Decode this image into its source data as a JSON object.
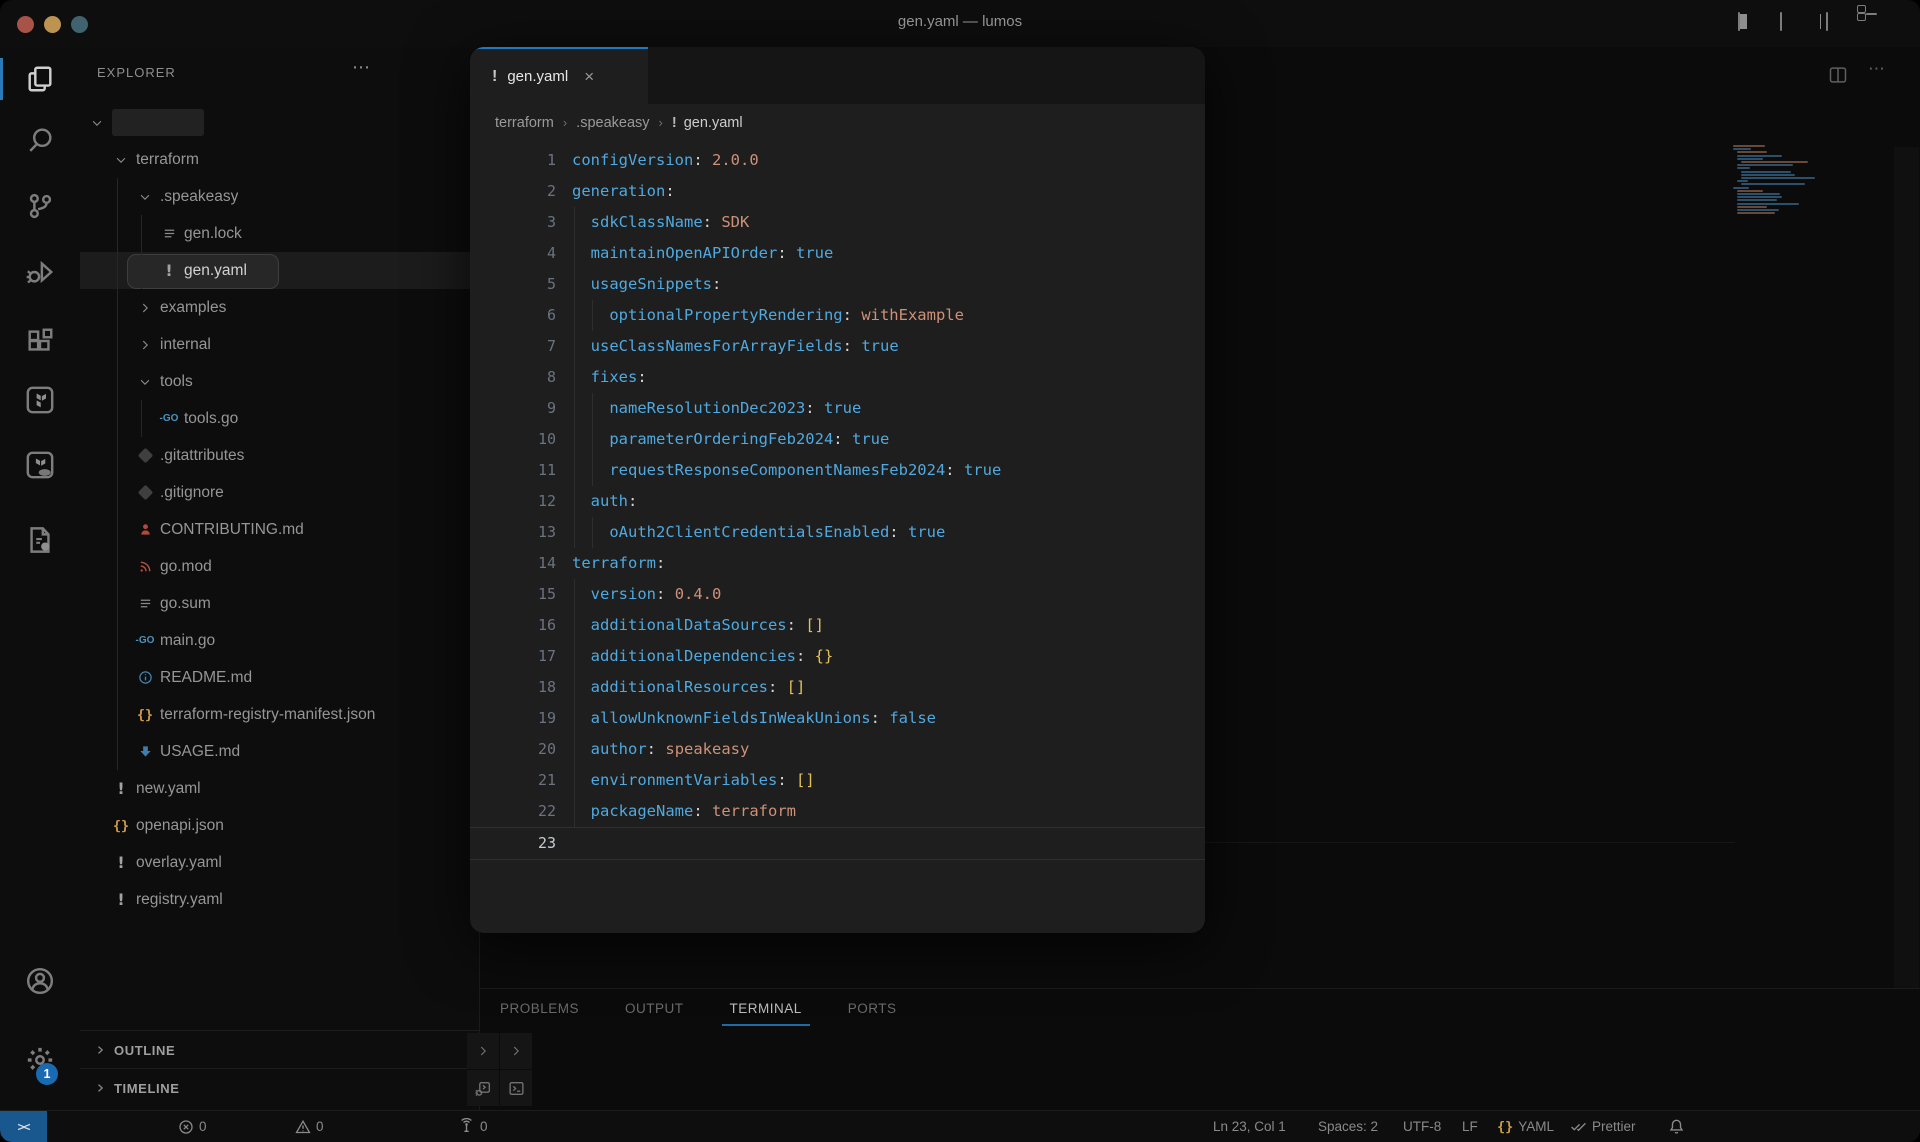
{
  "window": {
    "title": "gen.yaml — lumos",
    "traffic_lights": [
      "#a8534a",
      "#bd9350",
      "#41626f"
    ]
  },
  "titlebar_icons": [
    "layout-sidebar-left",
    "layout-panel",
    "layout-sidebar-right",
    "layout-customize"
  ],
  "activity_bar": {
    "items": [
      {
        "name": "explorer",
        "icon": "files",
        "active": true
      },
      {
        "name": "search",
        "icon": "search",
        "active": false
      },
      {
        "name": "source-control",
        "icon": "source-control",
        "active": false
      },
      {
        "name": "run-debug",
        "icon": "debug",
        "active": false
      },
      {
        "name": "extensions",
        "icon": "extensions",
        "active": false
      },
      {
        "name": "terraform",
        "icon": "terraform",
        "active": false
      },
      {
        "name": "terraform-cloud",
        "icon": "terraform-cloud",
        "active": false
      },
      {
        "name": "rest-client",
        "icon": "tool-file",
        "active": false
      },
      {
        "name": "accounts",
        "icon": "account",
        "active": false,
        "bottom": true
      },
      {
        "name": "settings",
        "icon": "gear",
        "active": false,
        "bottom": true,
        "badge": "1"
      }
    ]
  },
  "explorer": {
    "header": "EXPLORER",
    "more_label": "⋯",
    "tree": [
      {
        "label": "",
        "chev": "down",
        "level": 0,
        "blurred": true
      },
      {
        "label": "terraform",
        "chev": "down",
        "level": 1
      },
      {
        "label": ".speakeasy",
        "chev": "down",
        "level": 2,
        "guides": [
          1
        ]
      },
      {
        "label": "gen.lock",
        "icon": "list",
        "level": 3,
        "guides": [
          1,
          2
        ]
      },
      {
        "label": "gen.yaml",
        "icon": "warning",
        "level": 3,
        "guides": [
          1,
          2
        ],
        "selected": true
      },
      {
        "label": "examples",
        "chev": "right",
        "level": 2,
        "guides": [
          1
        ]
      },
      {
        "label": "internal",
        "chev": "right",
        "level": 2,
        "guides": [
          1
        ]
      },
      {
        "label": "tools",
        "chev": "down",
        "level": 2,
        "guides": [
          1
        ]
      },
      {
        "label": "tools.go",
        "icon": "go",
        "level": 3,
        "guides": [
          1,
          2
        ]
      },
      {
        "label": ".gitattributes",
        "icon": "git",
        "level": 2,
        "guides": [
          1
        ]
      },
      {
        "label": ".gitignore",
        "icon": "git",
        "level": 2,
        "guides": [
          1
        ]
      },
      {
        "label": "CONTRIBUTING.md",
        "icon": "person",
        "level": 2,
        "guides": [
          1
        ]
      },
      {
        "label": "go.mod",
        "icon": "gomod",
        "level": 2,
        "guides": [
          1
        ]
      },
      {
        "label": "go.sum",
        "icon": "list",
        "level": 2,
        "guides": [
          1
        ]
      },
      {
        "label": "main.go",
        "icon": "go",
        "level": 2,
        "guides": [
          1
        ]
      },
      {
        "label": "README.md",
        "icon": "info",
        "level": 2,
        "guides": [
          1
        ]
      },
      {
        "label": "terraform-registry-manifest.json",
        "icon": "braces",
        "level": 2,
        "guides": [
          1
        ]
      },
      {
        "label": "USAGE.md",
        "icon": "arrow-down",
        "level": 2,
        "guides": [
          1
        ]
      },
      {
        "label": "new.yaml",
        "icon": "warning",
        "level": 1
      },
      {
        "label": "openapi.json",
        "icon": "braces",
        "level": 1
      },
      {
        "label": "overlay.yaml",
        "icon": "warning",
        "level": 1
      },
      {
        "label": "registry.yaml",
        "icon": "warning",
        "level": 1
      }
    ],
    "sections": {
      "outline": "OUTLINE",
      "timeline": "TIMELINE"
    }
  },
  "editor": {
    "tab": {
      "label": "gen.yaml",
      "icon": "warning",
      "close": "×"
    },
    "breadcrumb": [
      {
        "label": "terraform"
      },
      {
        "label": ".speakeasy"
      },
      {
        "label": "gen.yaml",
        "icon": "warning"
      }
    ],
    "lines": [
      {
        "n": 1,
        "indent": 0,
        "key": "configVersion",
        "val": "2.0.0",
        "vt": "str"
      },
      {
        "n": 2,
        "indent": 0,
        "key": "generation"
      },
      {
        "n": 3,
        "indent": 1,
        "key": "sdkClassName",
        "val": "SDK",
        "vt": "str"
      },
      {
        "n": 4,
        "indent": 1,
        "key": "maintainOpenAPIOrder",
        "val": "true",
        "vt": "kw"
      },
      {
        "n": 5,
        "indent": 1,
        "key": "usageSnippets"
      },
      {
        "n": 6,
        "indent": 2,
        "key": "optionalPropertyRendering",
        "val": "withExample",
        "vt": "str"
      },
      {
        "n": 7,
        "indent": 1,
        "key": "useClassNamesForArrayFields",
        "val": "true",
        "vt": "kw"
      },
      {
        "n": 8,
        "indent": 1,
        "key": "fixes"
      },
      {
        "n": 9,
        "indent": 2,
        "key": "nameResolutionDec2023",
        "val": "true",
        "vt": "kw"
      },
      {
        "n": 10,
        "indent": 2,
        "key": "parameterOrderingFeb2024",
        "val": "true",
        "vt": "kw"
      },
      {
        "n": 11,
        "indent": 2,
        "key": "requestResponseComponentNamesFeb2024",
        "val": "true",
        "vt": "kw"
      },
      {
        "n": 12,
        "indent": 1,
        "key": "auth"
      },
      {
        "n": 13,
        "indent": 2,
        "key": "oAuth2ClientCredentialsEnabled",
        "val": "true",
        "vt": "kw"
      },
      {
        "n": 14,
        "indent": 0,
        "key": "terraform"
      },
      {
        "n": 15,
        "indent": 1,
        "key": "version",
        "val": "0.4.0",
        "vt": "str"
      },
      {
        "n": 16,
        "indent": 1,
        "key": "additionalDataSources",
        "val": "[]",
        "vt": "br"
      },
      {
        "n": 17,
        "indent": 1,
        "key": "additionalDependencies",
        "val": "{}",
        "vt": "br"
      },
      {
        "n": 18,
        "indent": 1,
        "key": "additionalResources",
        "val": "[]",
        "vt": "br"
      },
      {
        "n": 19,
        "indent": 1,
        "key": "allowUnknownFieldsInWeakUnions",
        "val": "false",
        "vt": "kw"
      },
      {
        "n": 20,
        "indent": 1,
        "key": "author",
        "val": "speakeasy",
        "vt": "str"
      },
      {
        "n": 21,
        "indent": 1,
        "key": "environmentVariables",
        "val": "[]",
        "vt": "br"
      },
      {
        "n": 22,
        "indent": 1,
        "key": "packageName",
        "val": "terraform",
        "vt": "str"
      },
      {
        "n": 23,
        "indent": 0,
        "current": true
      }
    ]
  },
  "panel": {
    "tabs": [
      {
        "label": "PROBLEMS",
        "active": false
      },
      {
        "label": "OUTPUT",
        "active": false
      },
      {
        "label": "TERMINAL",
        "active": true
      },
      {
        "label": "PORTS",
        "active": false
      }
    ],
    "corner_icons": [
      "chevron-right",
      "chevron-right",
      "debug-terminal",
      "terminal"
    ]
  },
  "status_bar": {
    "remote_glyph": "><",
    "left": [
      {
        "name": "errors",
        "icon": "error",
        "text": "0"
      },
      {
        "name": "warnings",
        "icon": "warning-triangle",
        "text": "0"
      },
      {
        "name": "ports-forwarded",
        "icon": "broadcast",
        "text": "0"
      }
    ],
    "right": [
      {
        "name": "cursor-position",
        "text": "Ln 23, Col 1"
      },
      {
        "name": "indentation",
        "text": "Spaces: 2"
      },
      {
        "name": "encoding",
        "text": "UTF-8"
      },
      {
        "name": "eol",
        "text": "LF"
      },
      {
        "name": "language-mode",
        "icon": "braces",
        "text": "YAML"
      },
      {
        "name": "formatter",
        "icon": "check-double",
        "text": "Prettier"
      },
      {
        "name": "notifications",
        "icon": "bell",
        "text": ""
      }
    ]
  },
  "colors": {
    "accent": "#1f78c4",
    "key": "#4fa9e0",
    "string": "#ce9178",
    "bracket": "#e2c15c",
    "selection_bg": "#272727",
    "spotlight_bg": "#1e1e1e",
    "dim_bg": "#0b0b0b"
  }
}
